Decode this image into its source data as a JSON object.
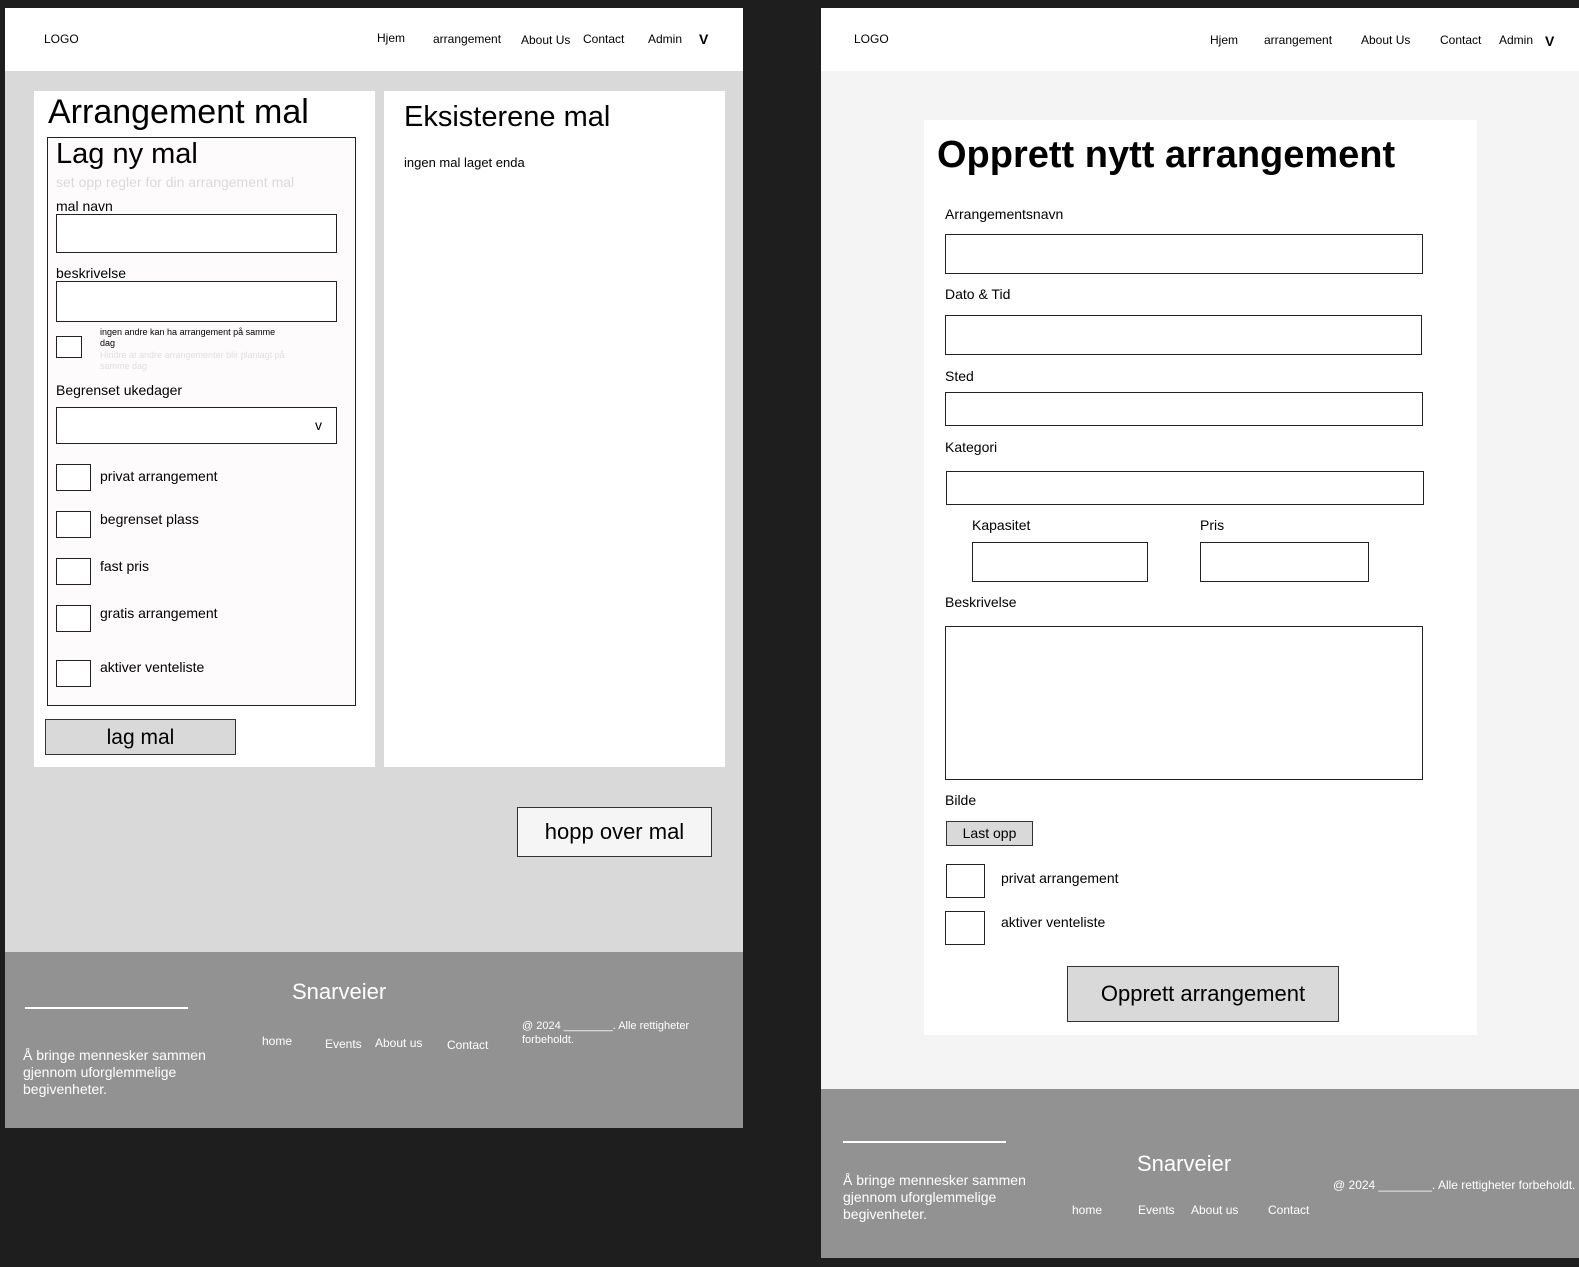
{
  "left": {
    "nav": {
      "logo": "LOGO",
      "links": [
        "Hjem",
        "arrangement",
        "About Us",
        "Contact",
        "Admin"
      ],
      "chevron": "V"
    },
    "template_panel": {
      "title": "Arrangement mal",
      "form_title": "Lag ny mal",
      "form_subtitle": "set opp regler for din arrangement mal",
      "name_label": "mal navn",
      "name_value": "",
      "description_label": "beskrivelse",
      "description_value": "",
      "exclusive_day_label_line1": "ingen andre kan ha arrangement på samme",
      "exclusive_day_label_line2": "dag",
      "exclusive_day_hint_line1": "Hindre at andre arrangementer blir planlagt på",
      "exclusive_day_hint_line2": "samme dag",
      "weekdays_label": "Begrenset ukedager",
      "weekdays_value": "",
      "weekdays_chevron": "v",
      "options": [
        "privat arrangement",
        "begrenset plass",
        "fast pris",
        "gratis arrangement",
        "aktiver venteliste"
      ],
      "create_button": "lag mal"
    },
    "existing_panel": {
      "title": "Eksisterene mal",
      "empty_text": "ingen mal laget enda"
    },
    "skip_button": "hopp over mal",
    "footer": {
      "tagline_line1": "Å bringe mennesker sammen",
      "tagline_line2": "gjennom uforglemmelige",
      "tagline_line3": "begivenheter.",
      "shortcuts_title": "Snarveier",
      "links": [
        "home",
        "Events",
        "About us",
        "Contact"
      ],
      "copyright_line1": "@ 2024 ________. Alle rettigheter",
      "copyright_line2": "forbeholdt."
    }
  },
  "right": {
    "nav": {
      "logo": "LOGO",
      "links": [
        "Hjem",
        "arrangement",
        "About Us",
        "Contact",
        "Admin"
      ],
      "chevron": "V"
    },
    "form": {
      "title": "Opprett nytt arrangement",
      "name_label": "Arrangementsnavn",
      "name_value": "",
      "datetime_label": "Dato & Tid",
      "datetime_value": "",
      "place_label": "Sted",
      "place_value": "",
      "category_label": "Kategori",
      "category_value": "",
      "capacity_label": "Kapasitet",
      "capacity_value": "",
      "price_label": "Pris",
      "price_value": "",
      "description_label": "Beskrivelse",
      "description_value": "",
      "image_label": "Bilde",
      "upload_button": "Last opp",
      "options": [
        "privat arrangement",
        "aktiver venteliste"
      ],
      "submit_button": "Opprett arrangement"
    },
    "footer": {
      "tagline_line1": "Å bringe mennesker sammen",
      "tagline_line2": "gjennom uforglemmelige",
      "tagline_line3": "begivenheter.",
      "shortcuts_title": "Snarveier",
      "links": [
        "home",
        "Events",
        "About us",
        "Contact"
      ],
      "copyright": "@ 2024 ________. Alle rettigheter forbeholdt."
    }
  }
}
